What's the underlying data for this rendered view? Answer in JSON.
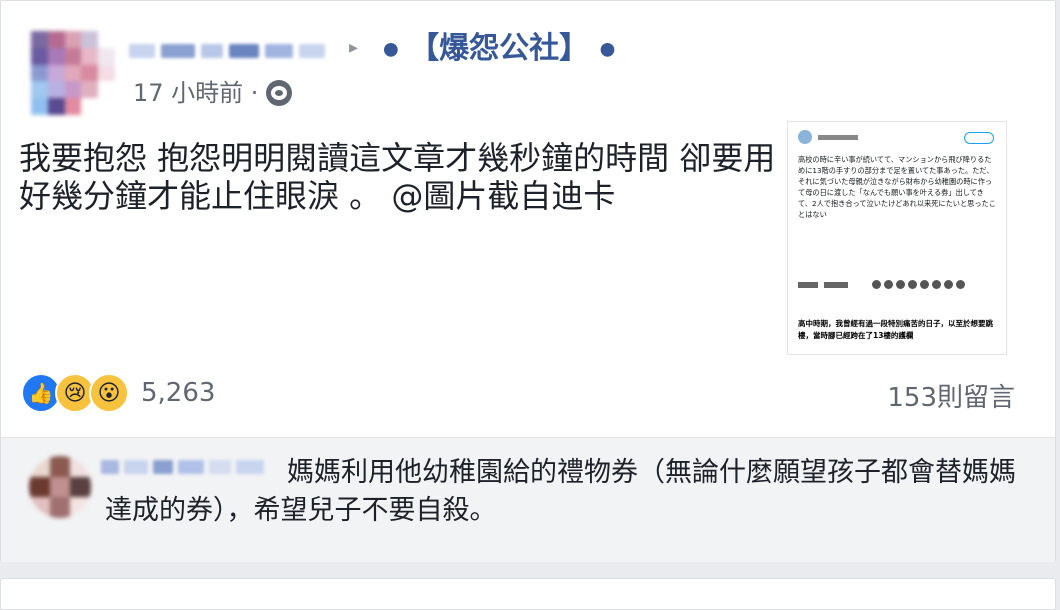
{
  "post": {
    "page_name": "【爆怨公社】",
    "time": "17 小時前 · ",
    "text": "我要抱怨 抱怨明明閱讀這文章才幾秒鐘的時間 卻要用好幾分鐘才能止住眼淚 。 @圖片截自迪卡",
    "reaction_count": "5,263",
    "comments_count": "153則留言"
  },
  "shared_image": {
    "tweet_text": "高校の時に辛い事が続いてて、マンションから飛び降りるために13階の手すりの部分まで足を置いてた事あった。ただ、それに気づいた母親が泣きながら財布から幼稚園の時に作って母の日に渡した「なんでも願い事を叶える券」出してきて、2人で抱き合って泣いたけどあれ以来死にたいと思ったことはない",
    "caption": "高中時期，我曾經有過一段特別痛苦的日子，以至於想要跳樓，當時腳已經跨在了13樓的護欄"
  },
  "comment": {
    "text": "媽媽利用他幼稚園給的禮物券（無論什麼願望孩子都會替媽媽達成的券），希望兒子不要自殺。"
  },
  "colors": {
    "page_link": "#365899",
    "like": "#2078f4",
    "emoji": "#f7c23e",
    "background": "#e9ebee"
  }
}
